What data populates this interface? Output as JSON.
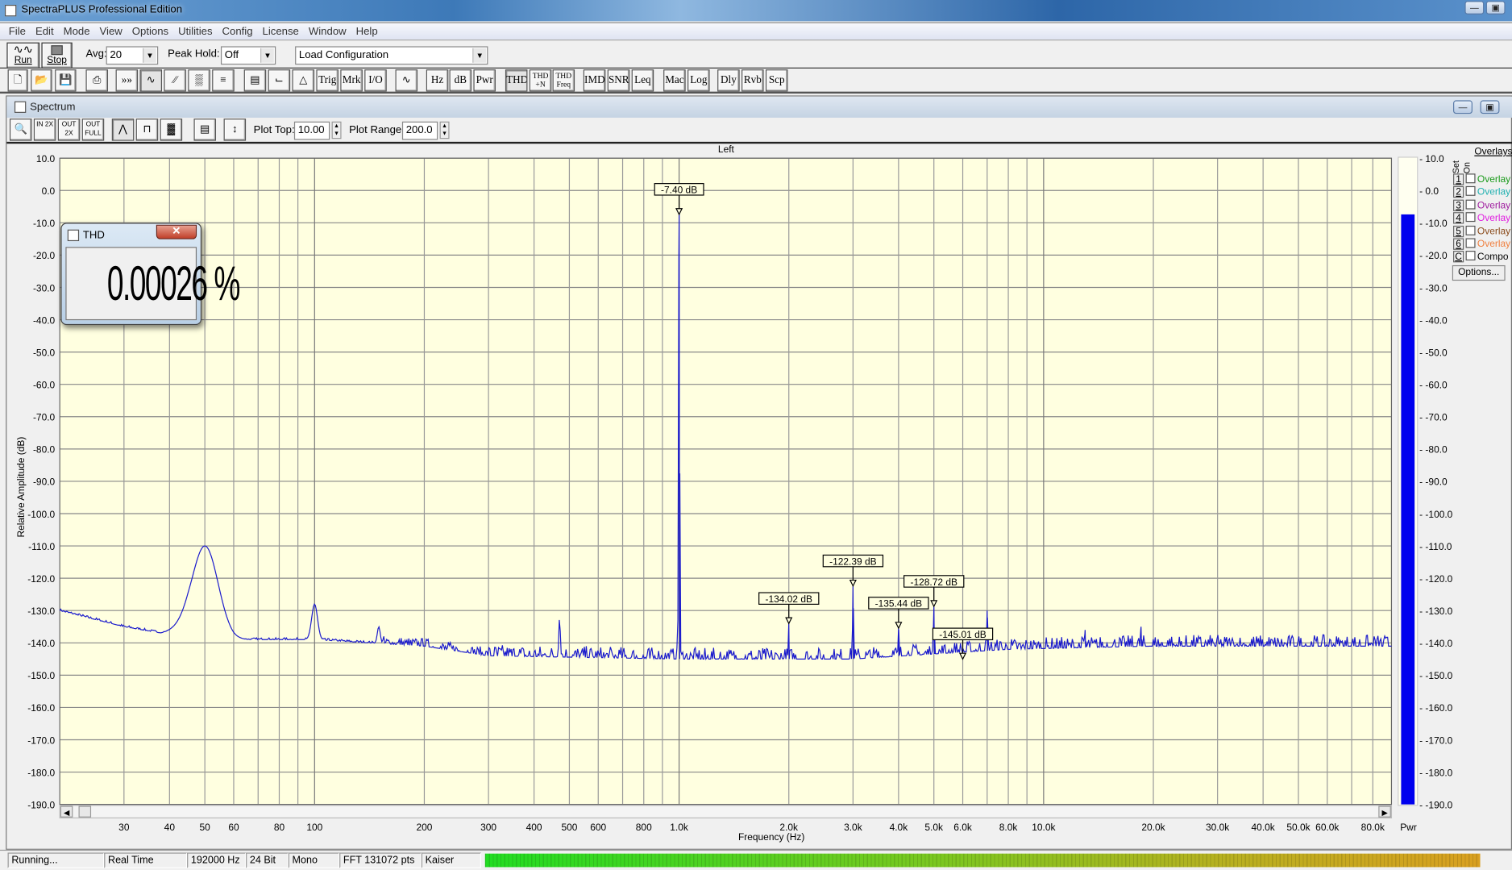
{
  "app": {
    "title": "SpectraPLUS Professional Edition"
  },
  "menu": [
    "File",
    "Edit",
    "Mode",
    "View",
    "Options",
    "Utilities",
    "Config",
    "License",
    "Window",
    "Help"
  ],
  "toolbar": {
    "run_label": "Run",
    "stop_label": "Stop",
    "avg_label": "Avg:",
    "avg_value": "20",
    "peak_hold_label": "Peak Hold:",
    "peak_hold_value": "Off",
    "config_value": "Load Configuration"
  },
  "toolbar2": {
    "trig": "Trig",
    "mrk": "Mrk",
    "io": "I/O",
    "hz": "Hz",
    "db": "dB",
    "pwr": "Pwr",
    "thd": "THD",
    "thdn": "THD +N",
    "thdfreq": "THD Freq",
    "imd": "IMD",
    "snr": "SNR",
    "leq": "Leq",
    "mac": "Mac",
    "log": "Log",
    "dly": "Dly",
    "rvb": "Rvb",
    "scp": "Scp"
  },
  "spectrum": {
    "title": "Spectrum",
    "plot_top_label": "Plot Top:",
    "plot_top_value": "10.00",
    "plot_range_label": "Plot Range:",
    "plot_range_value": "200.0",
    "zoom_in": "IN 2X",
    "zoom_out": "OUT 2X",
    "zoom_full": "OUT FULL"
  },
  "thd_window": {
    "title": "THD",
    "value": "0.00026 %"
  },
  "overlays": {
    "title": "Overlays",
    "set_label": "Set",
    "on_label": "On",
    "options_label": "Options...",
    "items": [
      {
        "n": "1",
        "label": "Overlay",
        "color": "#1a9a1a"
      },
      {
        "n": "2",
        "label": "Overlay",
        "color": "#20b0b0"
      },
      {
        "n": "3",
        "label": "Overlay",
        "color": "#a020a0"
      },
      {
        "n": "4",
        "label": "Overlay",
        "color": "#e020e0"
      },
      {
        "n": "5",
        "label": "Overlay",
        "color": "#8a4a1a"
      },
      {
        "n": "6",
        "label": "Overlay",
        "color": "#f08040"
      },
      {
        "n": "C",
        "label": "Compo",
        "color": "#000000"
      }
    ]
  },
  "pwr": {
    "label": "Pwr",
    "level_db": -7.4
  },
  "status": {
    "state": "Running...",
    "mode": "Real Time",
    "rate": "192000 Hz",
    "bits": "24 Bit",
    "channels": "Mono",
    "fft": "FFT 131072 pts",
    "window": "Kaiser"
  },
  "chart_data": {
    "type": "line",
    "title": "Left",
    "xlabel": "Frequency (Hz)",
    "ylabel": "Relative Amplitude (dB)",
    "xscale": "log",
    "xlim": [
      20,
      90000
    ],
    "ylim": [
      -190,
      10
    ],
    "grid": true,
    "yticks": [
      10,
      0,
      -10,
      -20,
      -30,
      -40,
      -50,
      -60,
      -70,
      -80,
      -90,
      -100,
      -110,
      -120,
      -130,
      -140,
      -150,
      -160,
      -170,
      -180,
      -190
    ],
    "xticks": [
      {
        "v": 30,
        "l": "30"
      },
      {
        "v": 40,
        "l": "40"
      },
      {
        "v": 50,
        "l": "50"
      },
      {
        "v": 60,
        "l": "60"
      },
      {
        "v": 80,
        "l": "80"
      },
      {
        "v": 100,
        "l": "100"
      },
      {
        "v": 200,
        "l": "200"
      },
      {
        "v": 300,
        "l": "300"
      },
      {
        "v": 400,
        "l": "400"
      },
      {
        "v": 500,
        "l": "500"
      },
      {
        "v": 600,
        "l": "600"
      },
      {
        "v": 800,
        "l": "800"
      },
      {
        "v": 1000,
        "l": "1.0k"
      },
      {
        "v": 2000,
        "l": "2.0k"
      },
      {
        "v": 3000,
        "l": "3.0k"
      },
      {
        "v": 4000,
        "l": "4.0k"
      },
      {
        "v": 5000,
        "l": "5.0k"
      },
      {
        "v": 6000,
        "l": "6.0k"
      },
      {
        "v": 8000,
        "l": "8.0k"
      },
      {
        "v": 10000,
        "l": "10.0k"
      },
      {
        "v": 20000,
        "l": "20.0k"
      },
      {
        "v": 30000,
        "l": "30.0k"
      },
      {
        "v": 40000,
        "l": "40.0k"
      },
      {
        "v": 50000,
        "l": "50.0k"
      },
      {
        "v": 60000,
        "l": "60.0k"
      },
      {
        "v": 80000,
        "l": "80.0k"
      }
    ],
    "noise_floor": [
      [
        20,
        -130
      ],
      [
        30,
        -135
      ],
      [
        38,
        -137
      ],
      [
        45,
        -135
      ],
      [
        60,
        -139
      ],
      [
        100,
        -139
      ],
      [
        200,
        -141
      ],
      [
        300,
        -144
      ],
      [
        1000,
        -145
      ],
      [
        3000,
        -145
      ],
      [
        8000,
        -142
      ],
      [
        20000,
        -141
      ],
      [
        90000,
        -141
      ]
    ],
    "peaks": [
      {
        "f": 50,
        "db": -110,
        "w": 0.035
      },
      {
        "f": 100,
        "db": -128,
        "w": 0.008
      },
      {
        "f": 150,
        "db": -135,
        "w": 0.004
      },
      {
        "f": 470,
        "db": -132,
        "w": 0.002
      },
      {
        "f": 1000,
        "db": -7.4,
        "w": 0.0015
      },
      {
        "f": 2000,
        "db": -134.02,
        "w": 0.001
      },
      {
        "f": 3000,
        "db": -122.39,
        "w": 0.001
      },
      {
        "f": 4000,
        "db": -135.44,
        "w": 0.001
      },
      {
        "f": 5000,
        "db": -128.72,
        "w": 0.001
      },
      {
        "f": 7000,
        "db": -130,
        "w": 0.001
      },
      {
        "f": 13000,
        "db": -136,
        "w": 0.001
      },
      {
        "f": 18500,
        "db": -135,
        "w": 0.001
      }
    ],
    "markers": [
      {
        "f": 1000,
        "db": -7.4,
        "label": "-7.40 dB"
      },
      {
        "f": 2000,
        "db": -134.02,
        "label": "-134.02 dB"
      },
      {
        "f": 3000,
        "db": -122.39,
        "label": "-122.39 dB"
      },
      {
        "f": 4000,
        "db": -135.44,
        "label": "-135.44 dB"
      },
      {
        "f": 5000,
        "db": -128.72,
        "label": "-128.72 dB"
      },
      {
        "f": 6000,
        "db": -145.01,
        "label": "-145.01 dB"
      }
    ]
  }
}
